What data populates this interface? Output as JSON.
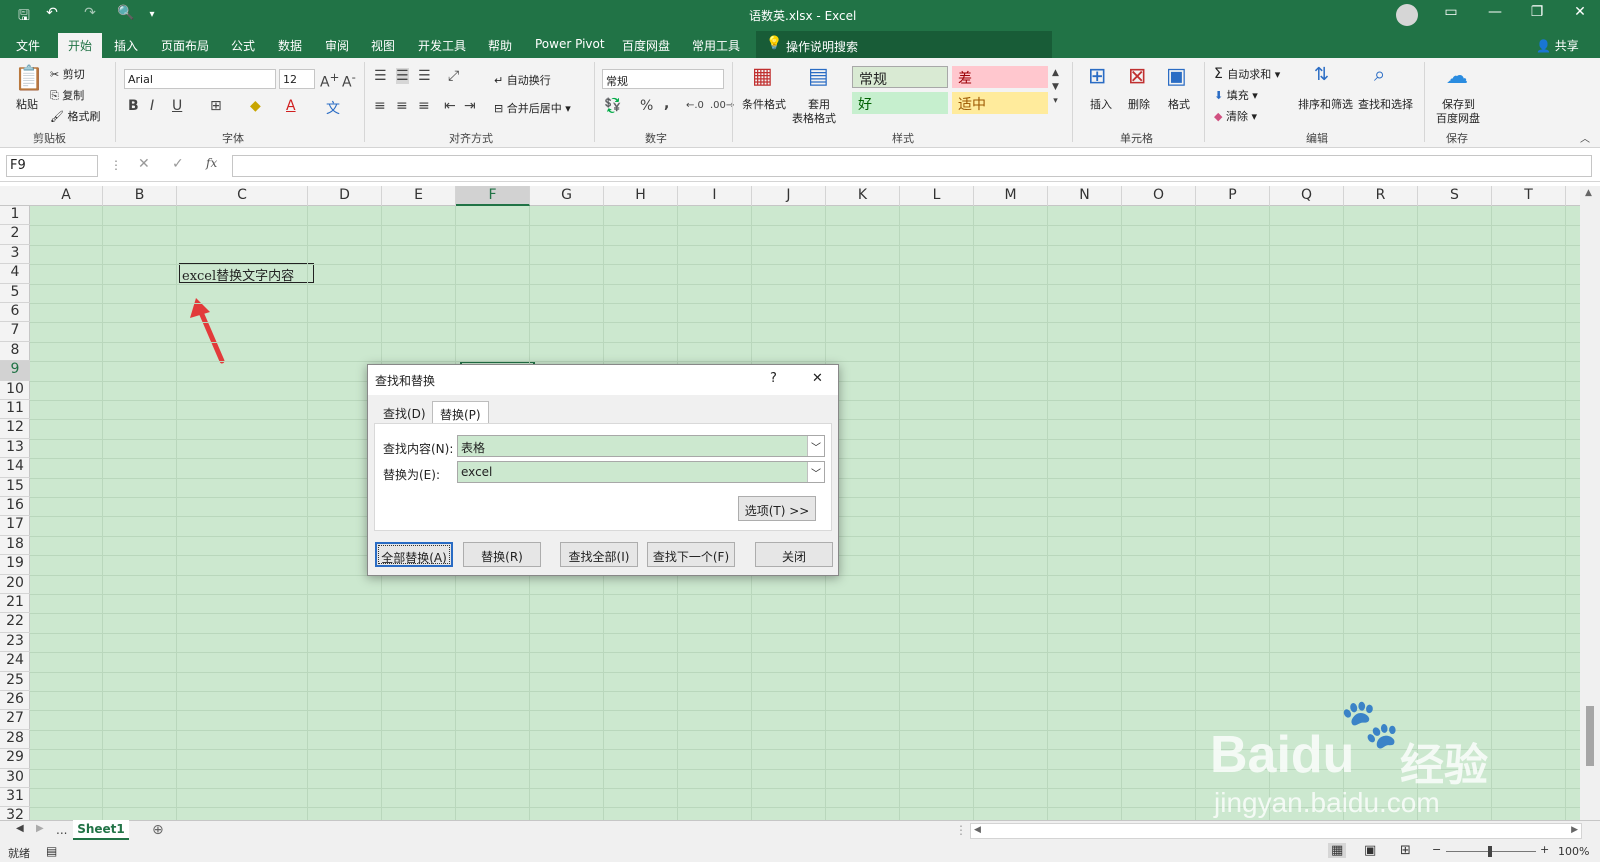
{
  "window": {
    "title": "语数英.xlsx  -  Excel",
    "share": "共享"
  },
  "tabs": [
    {
      "label": "文件"
    },
    {
      "label": "开始"
    },
    {
      "label": "插入"
    },
    {
      "label": "页面布局"
    },
    {
      "label": "公式"
    },
    {
      "label": "数据"
    },
    {
      "label": "审阅"
    },
    {
      "label": "视图"
    },
    {
      "label": "开发工具"
    },
    {
      "label": "帮助"
    },
    {
      "label": "Power Pivot"
    },
    {
      "label": "百度网盘"
    },
    {
      "label": "常用工具"
    }
  ],
  "tell_me": "操作说明搜索",
  "ribbon": {
    "clipboard": {
      "paste": "粘贴",
      "cut": "剪切",
      "copy": "复制",
      "format_painter": "格式刷",
      "label": "剪贴板"
    },
    "font": {
      "name": "Arial",
      "size": "12",
      "bold": "B",
      "italic": "I",
      "underline": "U",
      "label": "字体"
    },
    "alignment": {
      "wrap": "自动换行",
      "merge": "合并后居中",
      "label": "对齐方式"
    },
    "number": {
      "format": "常规",
      "percent": "%",
      "comma": ",",
      "label": "数字"
    },
    "styles": {
      "conditional": "条件格式",
      "table_1": "套用",
      "table_2": "表格格式",
      "normal": "常规",
      "bad": "差",
      "good": "好",
      "neutral": "适中",
      "label": "样式"
    },
    "cells": {
      "insert": "插入",
      "delete": "删除",
      "format": "格式",
      "label": "单元格"
    },
    "editing": {
      "autosum": "自动求和",
      "fill": "填充",
      "clear": "清除",
      "sort": "排序和筛选",
      "find": "查找和选择",
      "label": "编辑"
    },
    "save": {
      "line1": "保存到",
      "line2": "百度网盘",
      "label": "保存"
    }
  },
  "namebox": "F9",
  "fx": "fx",
  "columns": [
    "A",
    "B",
    "C",
    "D",
    "E",
    "F",
    "G",
    "H",
    "I",
    "J",
    "K",
    "L",
    "M",
    "N",
    "O",
    "P",
    "Q",
    "R",
    "S",
    "T"
  ],
  "rows": [
    "1",
    "2",
    "3",
    "4",
    "5",
    "6",
    "7",
    "8",
    "9",
    "10",
    "11",
    "12",
    "13",
    "14",
    "15",
    "16",
    "17",
    "18",
    "19",
    "20",
    "21",
    "22",
    "23",
    "24",
    "25",
    "26",
    "27",
    "28",
    "29",
    "30",
    "31",
    "32"
  ],
  "cell_c4": "excel替换文字内容",
  "sheets": {
    "ellipsis": "...",
    "active": "Sheet1"
  },
  "status": {
    "ready": "就绪",
    "zoom": "100%"
  },
  "dialog": {
    "title": "查找和替换",
    "help": "?",
    "close": "✕",
    "tab_find": "查找(D)",
    "tab_replace": "替换(P)",
    "find_label": "查找内容(N):",
    "find_value": "表格",
    "replace_label": "替换为(E):",
    "replace_value": "excel",
    "options": "选项(T) >>",
    "replace_all": "全部替换(A)",
    "replace": "替换(R)",
    "find_all": "查找全部(I)",
    "find_next": "查找下一个(F)",
    "close_btn": "关闭"
  },
  "watermark": {
    "brand": "Baidu",
    "cn": "经验",
    "url": "jingyan.baidu.com"
  },
  "colors": {
    "accent": "#217346",
    "grid_bg": "#cce8cf",
    "arrow": "#e23b3b"
  }
}
